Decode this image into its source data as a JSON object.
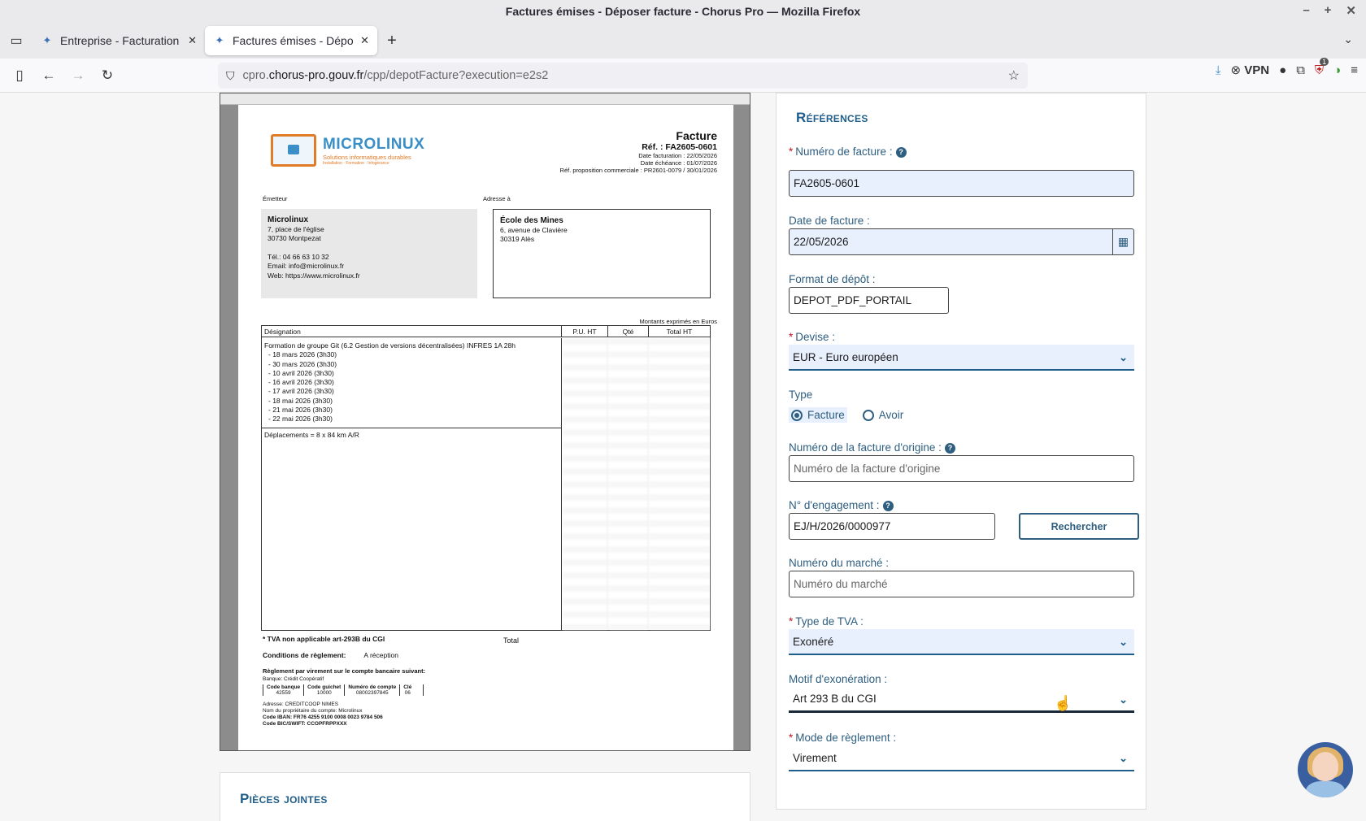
{
  "window": {
    "title": "Factures émises - Déposer facture - Chorus Pro — Mozilla Firefox"
  },
  "tabs": [
    {
      "label": "Entreprise - Facturation - Po",
      "active": false
    },
    {
      "label": "Factures émises - Déposer fa",
      "active": true
    }
  ],
  "url": {
    "host_prefix": "cpro.",
    "host": "chorus-pro.gouv.fr",
    "path": "/cpp/depotFacture?execution=e2s2"
  },
  "toolbar": {
    "vpn_label": "VPN",
    "ext_badge": "1"
  },
  "invoice_pdf": {
    "logo_name": "MICROLINUX",
    "logo_tagline": "Solutions informatiques durables",
    "logo_tagline2": "Installation · Formation · Infogérance",
    "title": "Facture",
    "ref": "Réf. : FA2605-0601",
    "date_facturation": "Date facturation : 22/05/2026",
    "date_echeance": "Date échéance : 01/07/2026",
    "ref_proposition": "Réf. proposition commerciale : PR2601-0079 / 30/01/2026",
    "emitter_label": "Émetteur",
    "address_label": "Adresse à",
    "emitter": {
      "name": "Microlinux",
      "street": "7, place de l'église",
      "city": "30730 Montpezat",
      "tel": "Tél.: 04 66 63 10 32",
      "email": "Email: info@microlinux.fr",
      "web": "Web: https://www.microlinux.fr"
    },
    "recipient": {
      "name": "École des Mines",
      "street": "6, avenue de Clavière",
      "city": "30319 Alès"
    },
    "amount_note": "Montants exprimés en Euros",
    "columns": {
      "designation": "Désignation",
      "pu": "P.U. HT",
      "qte": "Qté",
      "total": "Total HT"
    },
    "line1_title": "Formation de groupe Git (6.2 Gestion de versions décentralisées) INFRES 1A 28h",
    "line1_dates": [
      "- 18 mars 2026 (3h30)",
      "- 30 mars 2026 (3h30)",
      "- 10 avril 2026 (3h30)",
      "- 16 avril 2026 (3h30)",
      "- 17 avril 2026 (3h30)",
      "- 18 mai 2026 (3h30)",
      "- 21 mai 2026 (3h30)",
      "- 22 mai 2026 (3h30)"
    ],
    "line2": "Déplacements = 8 x 84 km A/R",
    "tva_note": "* TVA non applicable art-293B du CGI",
    "total_label": "Total",
    "conditions_label": "Conditions de règlement:",
    "conditions_value": "A réception",
    "virement_title": "Règlement par virement sur le compte bancaire suivant:",
    "bank_name": "Banque: Crédit Coopératif",
    "bank_headers": [
      "Code banque",
      "Code guichet",
      "Numéro de compte",
      "Clé"
    ],
    "bank_values": [
      "42559",
      "10000",
      "08002397845",
      "06"
    ],
    "bank_address": "Adresse: CREDITCOOP NIMES",
    "bank_owner": "Nom du propriétaire du compte: Microlinux",
    "iban": "Code IBAN: FR76 4255 9100 0008 0023 9784 506",
    "bic": "Code BIC/SWIFT: CCOPFRPPXXX"
  },
  "attachments": {
    "title": "Pièces jointes"
  },
  "form": {
    "title": "Références",
    "numero_facture": {
      "label": "Numéro de facture :",
      "value": "FA2605-0601"
    },
    "date_facture": {
      "label": "Date de facture :",
      "value": "22/05/2026"
    },
    "format_depot": {
      "label": "Format de dépôt :",
      "value": "DEPOT_PDF_PORTAIL"
    },
    "devise": {
      "label": "Devise :",
      "value": "EUR - Euro européen"
    },
    "type": {
      "label": "Type",
      "option_facture": "Facture",
      "option_avoir": "Avoir"
    },
    "facture_origine": {
      "label": "Numéro de la facture d'origine :",
      "placeholder": "Numéro de la facture d'origine"
    },
    "engagement": {
      "label": "N° d'engagement :",
      "value": "EJ/H/2026/0000977",
      "button": "Rechercher"
    },
    "marche": {
      "label": "Numéro du marché :",
      "placeholder": "Numéro du marché"
    },
    "type_tva": {
      "label": "Type de TVA :",
      "value": "Exonéré"
    },
    "motif_exoneration": {
      "label": "Motif d'exonération :",
      "value": "Art 293 B du CGI"
    },
    "mode_reglement": {
      "label": "Mode de règlement :",
      "value": "Virement"
    }
  },
  "colors": {
    "accent": "#1f5e8a",
    "required": "#c0181e",
    "filled_bg": "#e8f0fe"
  }
}
